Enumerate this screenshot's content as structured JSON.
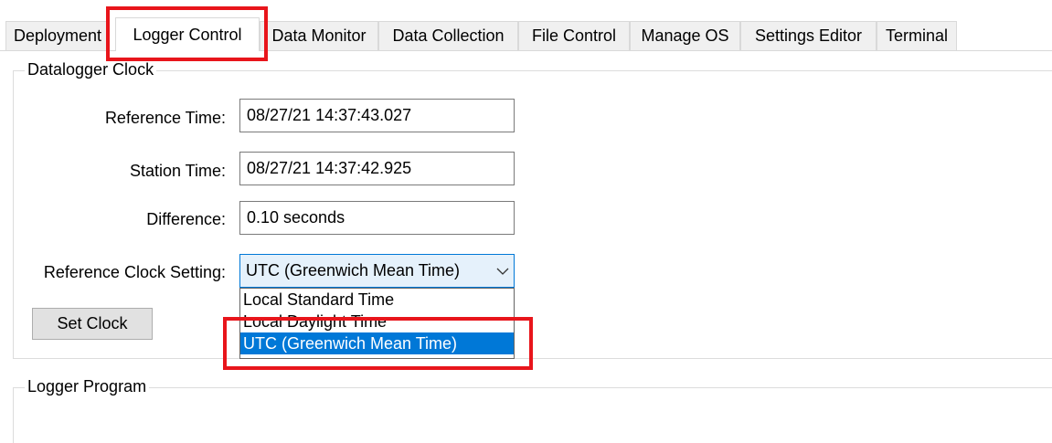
{
  "tabs": [
    {
      "label": "Deployment"
    },
    {
      "label": "Logger Control",
      "active": true
    },
    {
      "label": "Data Monitor"
    },
    {
      "label": "Data Collection"
    },
    {
      "label": "File Control"
    },
    {
      "label": "Manage OS"
    },
    {
      "label": "Settings Editor"
    },
    {
      "label": "Terminal"
    }
  ],
  "clock": {
    "group_title": "Datalogger Clock",
    "reference_time": {
      "label": "Reference Time:",
      "value": "08/27/21 14:37:43.027"
    },
    "station_time": {
      "label": "Station Time:",
      "value": "08/27/21 14:37:42.925"
    },
    "difference": {
      "label": "Difference:",
      "value": "0.10 seconds"
    },
    "reference_clock": {
      "label": "Reference Clock Setting:",
      "selected": "UTC (Greenwich Mean Time)",
      "options": [
        "Local Standard Time",
        "Local Daylight Time",
        "UTC (Greenwich Mean Time)"
      ]
    },
    "set_clock_label": "Set Clock"
  },
  "program": {
    "group_title": "Logger Program"
  },
  "colors": {
    "accent": "#0078d7",
    "highlight": "#e8151b",
    "selection_bg": "#0078d7",
    "combo_bg": "#e5f1fb"
  }
}
